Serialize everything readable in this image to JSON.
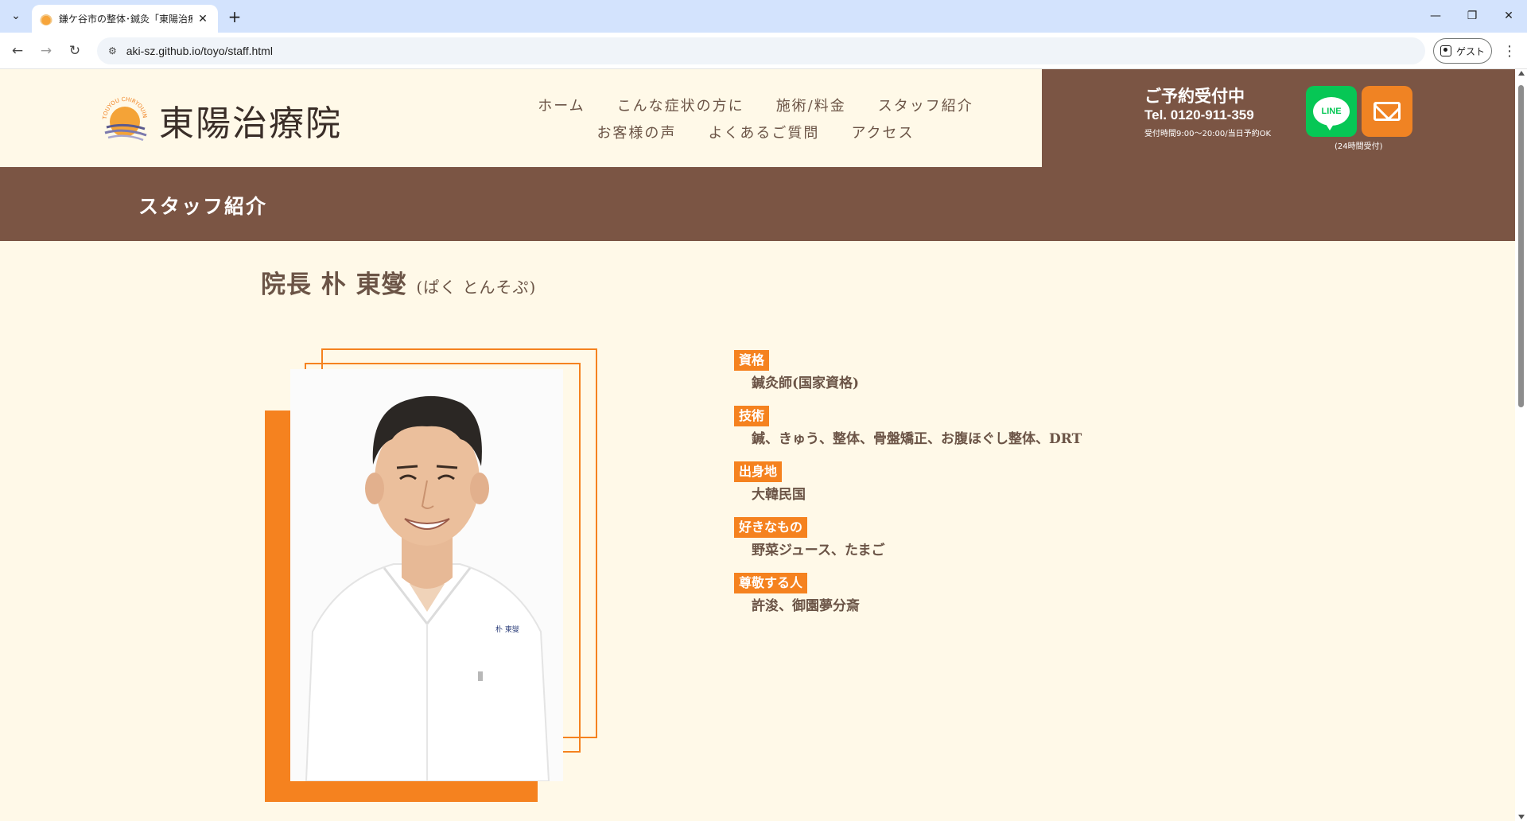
{
  "browser": {
    "tab_title": "鎌ケ谷市の整体･鍼灸「東陽治療院」",
    "url": "aki-sz.github.io/toyo/staff.html",
    "profile_label": "ゲスト",
    "icons": [
      "tab-list-icon",
      "favicon",
      "close-icon",
      "plus-icon",
      "minimize-icon",
      "restore-icon",
      "close-window-icon",
      "back-arrow-icon",
      "forward-arrow-icon",
      "reload-icon",
      "site-info-icon",
      "profile-icon",
      "kebab-menu-icon"
    ]
  },
  "header": {
    "logo_text": "東陽治療院",
    "logo_arc_text": "TOUYOU CHIRYOUIN",
    "nav_row1": [
      "ホーム",
      "こんな症状の方に",
      "施術/料金",
      "スタッフ紹介"
    ],
    "nav_row2": [
      "お客様の声",
      "よくあるご質問",
      "アクセス"
    ],
    "reserve_title": "ご予約受付中",
    "reserve_tel": "Tel. 0120-911-359",
    "reserve_hours": "受付時間9:00〜20:00/当日予約OK",
    "line_label": "LINE",
    "mail_caption": "(24時間受付)"
  },
  "page": {
    "title": "スタッフ紹介"
  },
  "staff": {
    "name": "院長 朴 東燮",
    "ruby": "(ぱく とんそぷ)",
    "name_tag": "朴 東燮",
    "profile": [
      {
        "label": "資格",
        "value": "鍼灸師(国家資格)"
      },
      {
        "label": "技術",
        "value": "鍼、きゅう、整体、骨盤矯正、お腹ほぐし整体、DRT"
      },
      {
        "label": "出身地",
        "value": "大韓民国"
      },
      {
        "label": "好きなもの",
        "value": "野菜ジュース、たまご"
      },
      {
        "label": "尊敬する人",
        "value": "許浚、御園夢分斎"
      }
    ]
  },
  "colors": {
    "brown": "#7b5544",
    "orange": "#f5821f",
    "cream": "#fff9e8",
    "line_green": "#06c755",
    "text_brown": "#6b5446"
  }
}
